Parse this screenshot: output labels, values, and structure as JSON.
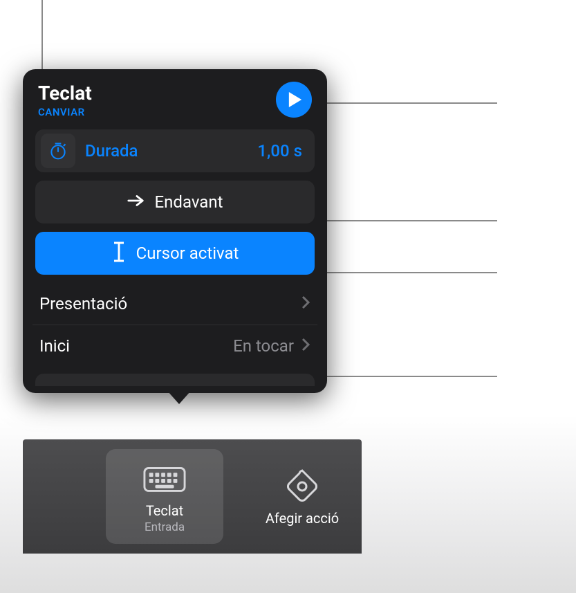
{
  "popover": {
    "title": "Teclat",
    "change_label": "CANVIAR",
    "duration": {
      "label": "Durada",
      "value": "1,00 s"
    },
    "direction": {
      "label": "Endavant"
    },
    "cursor": {
      "label": "Cursor activat"
    },
    "presentation": {
      "label": "Presentació"
    },
    "start": {
      "label": "Inici",
      "value": "En tocar"
    }
  },
  "toolbar": {
    "keyboard": {
      "title": "Teclat",
      "subtitle": "Entrada"
    },
    "add_action": {
      "title": "Afegir acció"
    }
  },
  "colors": {
    "accent": "#0a84ff",
    "panel": "#1d1d1f",
    "row": "#2a2a2c"
  }
}
